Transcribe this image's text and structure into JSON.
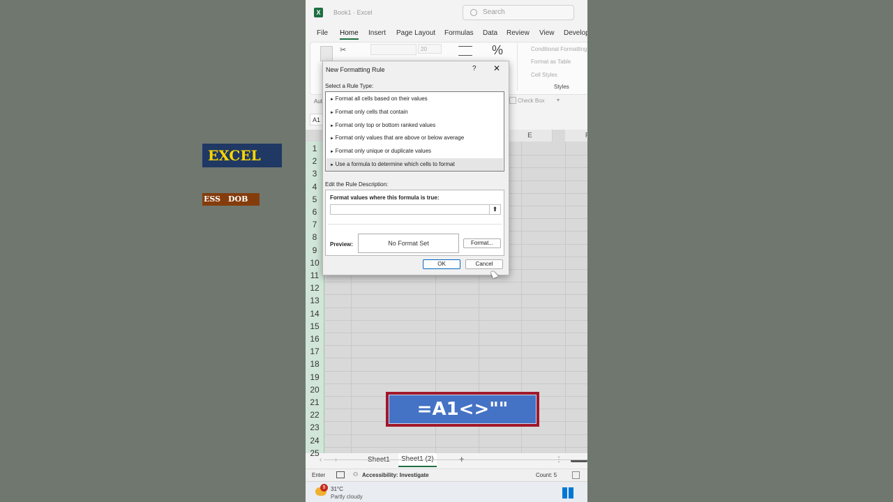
{
  "window": {
    "title": "Book1 · Excel",
    "search_placeholder": "Search"
  },
  "menu": [
    "File",
    "Home",
    "Insert",
    "Page Layout",
    "Formulas",
    "Data",
    "Review",
    "View",
    "Develop"
  ],
  "ribbon": {
    "font_size": "20",
    "styles_items": [
      "Conditional Formatting",
      "Format as Table",
      "Cell Styles"
    ],
    "styles_group_label": "Styles",
    "checkbox_label": "Check Box",
    "autosum_label": "Aut"
  },
  "namebox": "A1",
  "columns": [
    "E",
    "F"
  ],
  "rows": [
    "1",
    "2",
    "3",
    "4",
    "5",
    "6",
    "7",
    "8",
    "9",
    "10",
    "11",
    "12",
    "13",
    "14",
    "15",
    "16",
    "17",
    "18",
    "19",
    "20",
    "21",
    "22",
    "23",
    "24",
    "25"
  ],
  "sheet_cells": {
    "banner": "EXCEL",
    "header_left": "ESS",
    "header_right": "DOB"
  },
  "formula_callout": "=A1<>\"\"",
  "sheet_tabs": [
    "Sheet1",
    "Sheet1 (2)"
  ],
  "status": {
    "mode": "Enter",
    "accessibility": "Accessibility: Investigate",
    "count": "Count: 5"
  },
  "taskbar": {
    "badge": "9",
    "temp": "31°C",
    "weather": "Partly cloudy"
  },
  "dialog": {
    "title": "New Formatting Rule",
    "help": "?",
    "close": "✕",
    "rule_type_label": "Select a Rule Type:",
    "rule_types": [
      "Format all cells based on their values",
      "Format only cells that contain",
      "Format only top or bottom ranked values",
      "Format only values that are above or below average",
      "Format only unique or duplicate values",
      "Use a formula to determine which cells to format"
    ],
    "selected_rule": 5,
    "edit_label": "Edit the Rule Description:",
    "formula_heading": "Format values where this formula is true:",
    "formula_value": "",
    "preview_label": "Preview:",
    "preview_text": "No Format Set",
    "format_button": "Format...",
    "ok": "OK",
    "cancel": "Cancel"
  },
  "colors": {
    "excel_green": "#1d6f42",
    "banner_bg": "#1f3864",
    "banner_text": "#ffd700",
    "header_bg": "#843c0c",
    "callout_blue": "#4472c4",
    "callout_border": "#a0192a"
  }
}
